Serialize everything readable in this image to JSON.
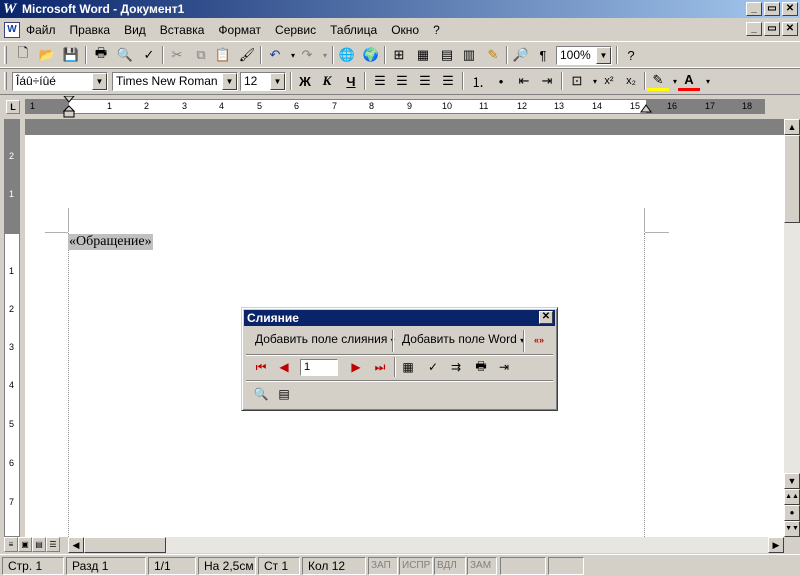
{
  "window": {
    "title": "Microsoft Word - Документ1",
    "app_icon": "word-icon",
    "controls": [
      "_",
      "▭",
      "✕"
    ]
  },
  "menu": {
    "items": [
      "Файл",
      "Правка",
      "Вид",
      "Вставка",
      "Формат",
      "Сервис",
      "Таблица",
      "Окно",
      "?"
    ]
  },
  "toolbar_standard": {
    "zoom": "100%"
  },
  "toolbar_format": {
    "style": "Îáû÷íûé",
    "font": "Times New Roman",
    "size": "12",
    "bold": "Ж",
    "italic": "К",
    "underline": "Ч"
  },
  "ruler": {
    "numbers": [
      "1",
      "1",
      "2",
      "3",
      "4",
      "5",
      "6",
      "7",
      "8",
      "9",
      "10",
      "11",
      "12",
      "13",
      "14",
      "15",
      "16",
      "17",
      "18"
    ],
    "corner": "L"
  },
  "vruler": {
    "numbers": [
      "2",
      "1",
      "1",
      "2",
      "3",
      "4",
      "5",
      "6",
      "7"
    ]
  },
  "document": {
    "merge_field": "«Обращение»"
  },
  "mail_merge_toolbar": {
    "title": "Слияние",
    "insert_merge_field": "Добавить поле слияния",
    "insert_word_field": "Добавить поле Word",
    "record_number": "1"
  },
  "status": {
    "page": "Стр. 1",
    "section": "Разд 1",
    "pages": "1/1",
    "at": "На 2,5см",
    "line": "Ст 1",
    "col": "Кол 12",
    "rec": "ЗАП",
    "trk": "ИСПР",
    "ext": "ВДЛ",
    "ovr": "ЗАМ"
  },
  "colors": {
    "title_bar": "#0a246a",
    "chrome": "#d4d0c8",
    "workspace": "#808080",
    "field_shading": "#c0c0c0"
  }
}
